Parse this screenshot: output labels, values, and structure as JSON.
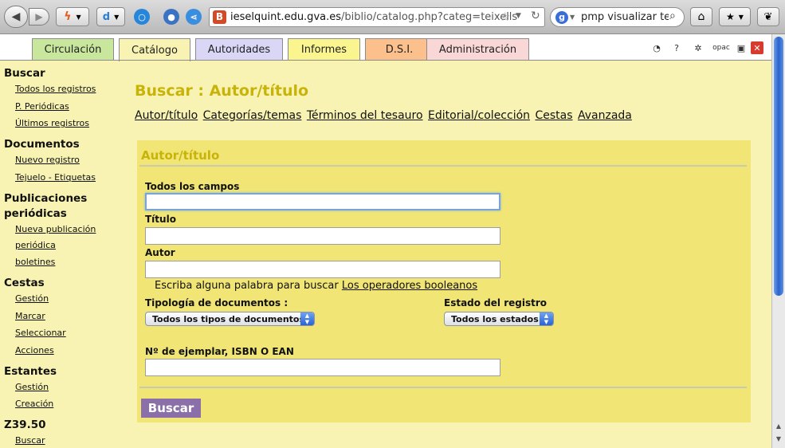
{
  "browser": {
    "back_glyph": "◀",
    "forward_glyph": "▶",
    "url_host": "ieselquint.edu.gva.es",
    "url_path": "/biblio/catalog.php?categ=teixells",
    "site_icon_letter": "B",
    "search_engine_letter": "g",
    "search_value": "pmp visualizar teju",
    "icons": [
      "back-arrow-icon",
      "forward-arrow-icon",
      "addon-icon",
      "circle-icon",
      "bookmark-star-icon",
      "reload-icon",
      "search-icon",
      "home-icon",
      "bookmarks-icon",
      "evernote-icon"
    ]
  },
  "tabs": {
    "circulacion": "Circulación",
    "catalogo": "Catálogo",
    "autoridades": "Autoridades",
    "informes": "Informes",
    "dsi": "D.S.I.",
    "administracion": "Administración",
    "opac_label": "opac"
  },
  "colors": {
    "page_bg": "#f8f3b3",
    "panel_bg": "#f1e675",
    "title_color": "#c8b308",
    "button_bg": "#8a6fa8",
    "tab_circulacion": "#c8e79c",
    "tab_autoridades": "#d9d6f6",
    "tab_informes": "#fbf58f",
    "tab_dsi": "#fbc08c",
    "tab_administracion": "#f9d7d7"
  },
  "sidebar": {
    "buscar": "Buscar",
    "todos_registros": "Todos los registros",
    "p_periodicas": "P. Periódicas",
    "ultimos_registros": "Últimos registros",
    "documentos": "Documentos",
    "nuevo_registro": "Nuevo registro",
    "tejuelo": "Tejuelo - Etiquetas",
    "publicaciones_1": "Publicaciones",
    "publicaciones_2": "periódicas",
    "nueva_publicacion_1": "Nueva publicación",
    "nueva_publicacion_2": "periódica",
    "boletines": "boletines",
    "cestas": "Cestas",
    "cestas_gestion": "Gestión",
    "marcar": "Marcar",
    "seleccionar": "Seleccionar",
    "acciones": "Acciones",
    "estantes": "Estantes",
    "estantes_gestion": "Gestión",
    "creacion": "Creación",
    "z3950": "Z39.50",
    "z_buscar": "Buscar"
  },
  "main": {
    "title": "Buscar : Autor/título",
    "subnav": [
      "Autor/título",
      "Categorías/temas",
      "Términos del tesauro",
      "Editorial/colección",
      "Cestas",
      "Avanzada"
    ],
    "panel_title": "Autor/título",
    "todos_campos": "Todos los campos",
    "titulo": "Título",
    "autor": "Autor",
    "hint_text": "Escriba alguna palabra para buscar",
    "hint_link": "Los operadores booleanos",
    "tipologia_label": "Tipología de documentos :",
    "tipologia_value": "Todos los tipos de documentos",
    "estado_label": "Estado del registro",
    "estado_value": "Todos los estados",
    "ejemplar_label": "Nº de ejemplar, ISBN O EAN",
    "submit": "Buscar"
  }
}
